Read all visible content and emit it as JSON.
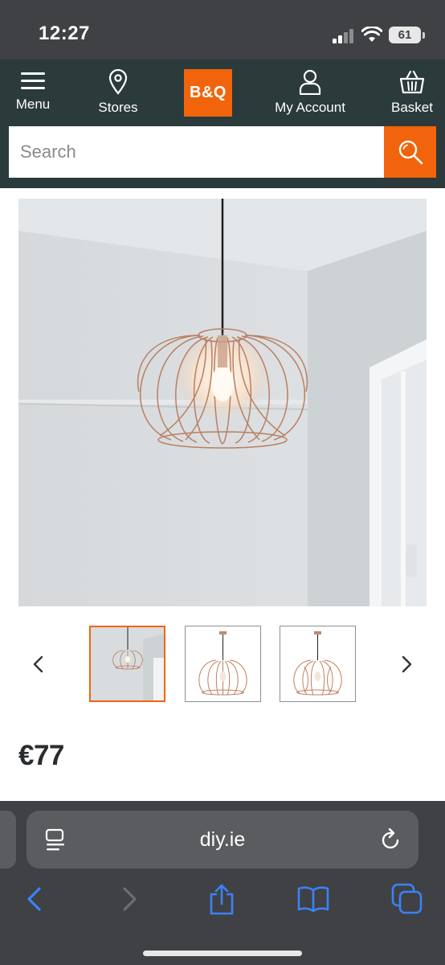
{
  "status": {
    "time": "12:27",
    "battery": "61"
  },
  "header": {
    "menu_label": "Menu",
    "stores_label": "Stores",
    "logo_text": "B&Q",
    "account_label": "My Account",
    "basket_label": "Basket",
    "brand_color": "#f2640b",
    "header_color": "#2b3a3a"
  },
  "search": {
    "placeholder": "Search",
    "value": ""
  },
  "product": {
    "price": "€77",
    "gallery": {
      "thumbnail_count": 3,
      "selected_index": 0
    }
  },
  "browser": {
    "url": "diy.ie",
    "accent": "#3b82f6"
  }
}
